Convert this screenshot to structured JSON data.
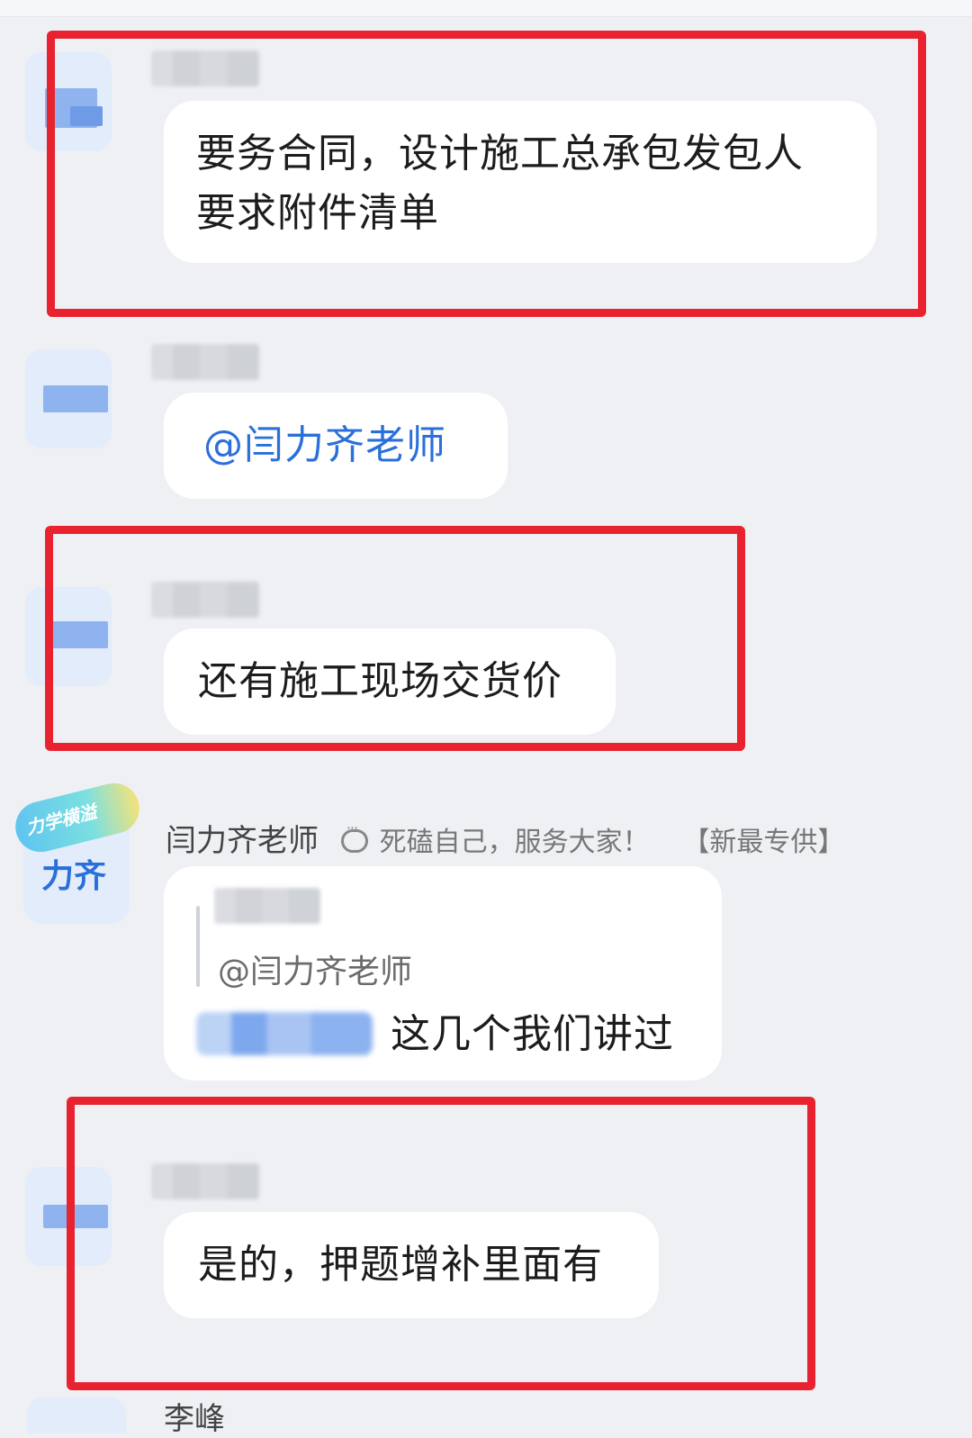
{
  "messages": [
    {
      "text_line1": "要务合同，设计施工总承包发包人",
      "text_line2": "要求附件清单"
    },
    {
      "text": "@闫力齐老师"
    },
    {
      "text": "还有施工现场交货价"
    }
  ],
  "teacher_message": {
    "avatar_badge": "力学横溢",
    "avatar_name": "力齐",
    "sender_name": "闫力齐老师",
    "signature": "死磕自己，服务大家！",
    "tag": "【新最专供】",
    "quote_mention": "@闫力齐老师",
    "reply_text": "这几个我们讲过"
  },
  "last_message": {
    "text": "是的，押题增补里面有"
  },
  "bottom_sender": "李峰",
  "colors": {
    "highlight_box": "#e8232f",
    "mention": "#2a6fdb",
    "background": "#eef0f4"
  }
}
